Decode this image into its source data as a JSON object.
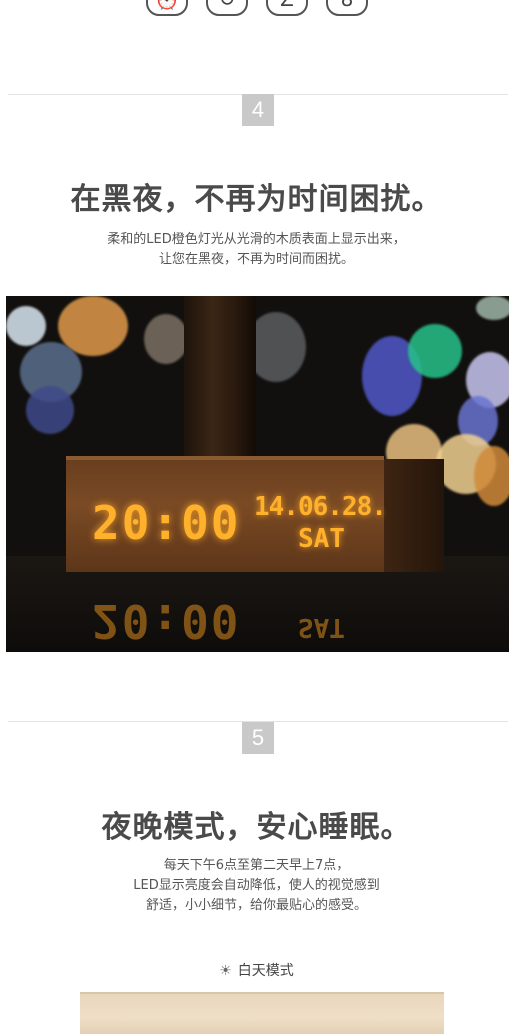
{
  "top_icons": [
    {
      "icon": "alarm-icon",
      "glyph": "⏰"
    },
    {
      "icon": "refresh-icon",
      "glyph": "↻"
    },
    {
      "icon": "sleep-icon",
      "glyph": "Z"
    },
    {
      "icon": "thermometer-icon",
      "glyph": "🌡"
    }
  ],
  "section4": {
    "number": "4",
    "title": "在黑夜，不再为时间困扰。",
    "desc_line1": "柔和的LED橙色灯光从光滑的木质表面上显示出来，",
    "desc_line2": "让您在黑夜，不再为时间而困扰。",
    "photo": {
      "time": "20:00",
      "date": "14.06.28.",
      "day": "SAT",
      "led_color": "#ffb12c"
    }
  },
  "section5": {
    "number": "5",
    "title": "夜晚模式，安心睡眠。",
    "desc_line1": "每天下午6点至第二天早上7点，",
    "desc_line2": "LED显示亮度会自动降低，使人的视觉感到",
    "desc_line3": "舒适，小小细节，给你最贴心的感受。",
    "mode_label": "白天模式",
    "mode_icon": "sun-icon"
  }
}
